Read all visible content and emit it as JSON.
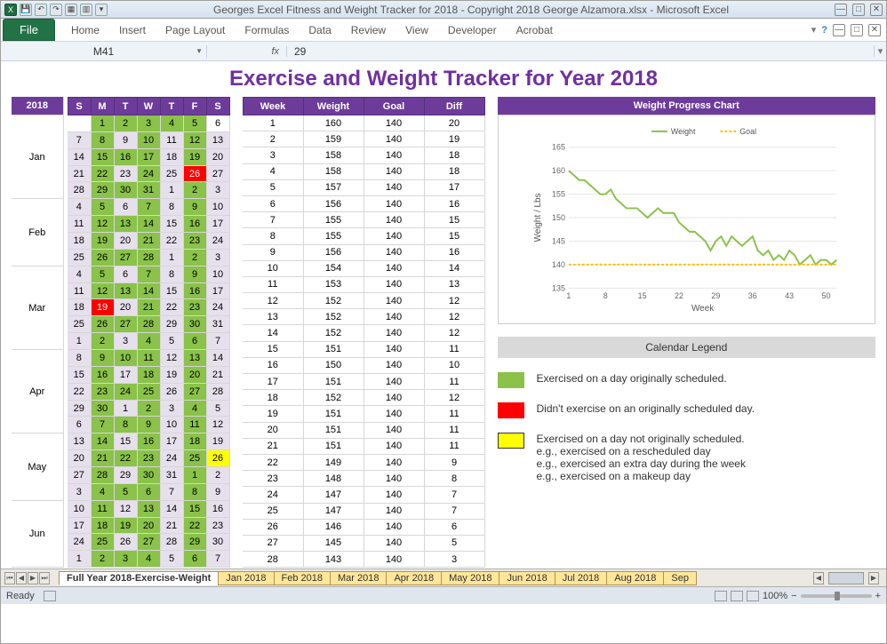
{
  "window_title": "Georges Excel Fitness and Weight Tracker for 2018 - Copyright 2018 George Alzamora.xlsx  -  Microsoft Excel",
  "ribbon": {
    "file": "File",
    "tabs": [
      "Home",
      "Insert",
      "Page Layout",
      "Formulas",
      "Data",
      "Review",
      "View",
      "Developer",
      "Acrobat"
    ]
  },
  "formula": {
    "name_box": "M41",
    "fx": "fx",
    "value": "29"
  },
  "page_title": "Exercise and Weight Tracker for Year 2018",
  "year_label": "2018",
  "months": [
    "Jan",
    "Feb",
    "Mar",
    "Apr",
    "May",
    "Jun"
  ],
  "dow": [
    "S",
    "M",
    "T",
    "W",
    "T",
    "F",
    "S"
  ],
  "calendar_rows": [
    [
      "",
      "1",
      "2",
      "3",
      "4",
      "5",
      "6",
      "",
      "g",
      "g",
      "g",
      "g",
      "g",
      ""
    ],
    [
      "7",
      "8",
      "9",
      "10",
      "11",
      "12",
      "13",
      "p",
      "g",
      "p",
      "g",
      "p",
      "g",
      "p"
    ],
    [
      "14",
      "15",
      "16",
      "17",
      "18",
      "19",
      "20",
      "p",
      "g",
      "g",
      "g",
      "p",
      "g",
      "p"
    ],
    [
      "21",
      "22",
      "23",
      "24",
      "25",
      "26",
      "27",
      "p",
      "g",
      "p",
      "g",
      "p",
      "r",
      "p"
    ],
    [
      "28",
      "29",
      "30",
      "31",
      "1",
      "2",
      "3",
      "p",
      "g",
      "g",
      "g",
      "p",
      "g",
      "p"
    ],
    [
      "4",
      "5",
      "6",
      "7",
      "8",
      "9",
      "10",
      "p",
      "g",
      "p",
      "g",
      "p",
      "g",
      "p"
    ],
    [
      "11",
      "12",
      "13",
      "14",
      "15",
      "16",
      "17",
      "p",
      "g",
      "g",
      "g",
      "p",
      "g",
      "p"
    ],
    [
      "18",
      "19",
      "20",
      "21",
      "22",
      "23",
      "24",
      "p",
      "g",
      "p",
      "g",
      "p",
      "g",
      "p"
    ],
    [
      "25",
      "26",
      "27",
      "28",
      "1",
      "2",
      "3",
      "p",
      "g",
      "g",
      "g",
      "p",
      "g",
      "p"
    ],
    [
      "4",
      "5",
      "6",
      "7",
      "8",
      "9",
      "10",
      "p",
      "g",
      "p",
      "g",
      "p",
      "g",
      "p"
    ],
    [
      "11",
      "12",
      "13",
      "14",
      "15",
      "16",
      "17",
      "p",
      "g",
      "g",
      "g",
      "p",
      "g",
      "p"
    ],
    [
      "18",
      "19",
      "20",
      "21",
      "22",
      "23",
      "24",
      "p",
      "r",
      "p",
      "g",
      "p",
      "g",
      "p"
    ],
    [
      "25",
      "26",
      "27",
      "28",
      "29",
      "30",
      "31",
      "p",
      "g",
      "g",
      "g",
      "p",
      "g",
      "p"
    ],
    [
      "1",
      "2",
      "3",
      "4",
      "5",
      "6",
      "7",
      "p",
      "g",
      "p",
      "g",
      "p",
      "g",
      "p"
    ],
    [
      "8",
      "9",
      "10",
      "11",
      "12",
      "13",
      "14",
      "p",
      "g",
      "g",
      "g",
      "p",
      "g",
      "p"
    ],
    [
      "15",
      "16",
      "17",
      "18",
      "19",
      "20",
      "21",
      "p",
      "g",
      "p",
      "g",
      "p",
      "g",
      "p"
    ],
    [
      "22",
      "23",
      "24",
      "25",
      "26",
      "27",
      "28",
      "p",
      "g",
      "g",
      "g",
      "p",
      "g",
      "p"
    ],
    [
      "29",
      "30",
      "1",
      "2",
      "3",
      "4",
      "5",
      "p",
      "g",
      "p",
      "g",
      "p",
      "g",
      "p"
    ],
    [
      "6",
      "7",
      "8",
      "9",
      "10",
      "11",
      "12",
      "p",
      "g",
      "g",
      "g",
      "p",
      "g",
      "p"
    ],
    [
      "13",
      "14",
      "15",
      "16",
      "17",
      "18",
      "19",
      "p",
      "g",
      "p",
      "g",
      "p",
      "g",
      "p"
    ],
    [
      "20",
      "21",
      "22",
      "23",
      "24",
      "25",
      "26",
      "p",
      "g",
      "g",
      "g",
      "p",
      "g",
      "y"
    ],
    [
      "27",
      "28",
      "29",
      "30",
      "31",
      "1",
      "2",
      "p",
      "g",
      "p",
      "g",
      "p",
      "g",
      "p"
    ],
    [
      "3",
      "4",
      "5",
      "6",
      "7",
      "8",
      "9",
      "p",
      "g",
      "g",
      "g",
      "p",
      "g",
      "p"
    ],
    [
      "10",
      "11",
      "12",
      "13",
      "14",
      "15",
      "16",
      "p",
      "g",
      "p",
      "g",
      "p",
      "g",
      "p"
    ],
    [
      "17",
      "18",
      "19",
      "20",
      "21",
      "22",
      "23",
      "p",
      "g",
      "g",
      "g",
      "p",
      "g",
      "p"
    ],
    [
      "24",
      "25",
      "26",
      "27",
      "28",
      "29",
      "30",
      "p",
      "g",
      "p",
      "g",
      "p",
      "g",
      "p"
    ],
    [
      "1",
      "2",
      "3",
      "4",
      "5",
      "6",
      "7",
      "p",
      "g",
      "g",
      "g",
      "p",
      "g",
      "p"
    ]
  ],
  "weight_header": [
    "Week",
    "Weight",
    "Goal",
    "Diff"
  ],
  "weight_rows": [
    [
      1,
      160,
      140,
      20
    ],
    [
      2,
      159,
      140,
      19
    ],
    [
      3,
      158,
      140,
      18
    ],
    [
      4,
      158,
      140,
      18
    ],
    [
      5,
      157,
      140,
      17
    ],
    [
      6,
      156,
      140,
      16
    ],
    [
      7,
      155,
      140,
      15
    ],
    [
      8,
      155,
      140,
      15
    ],
    [
      9,
      156,
      140,
      16
    ],
    [
      10,
      154,
      140,
      14
    ],
    [
      11,
      153,
      140,
      13
    ],
    [
      12,
      152,
      140,
      12
    ],
    [
      13,
      152,
      140,
      12
    ],
    [
      14,
      152,
      140,
      12
    ],
    [
      15,
      151,
      140,
      11
    ],
    [
      16,
      150,
      140,
      10
    ],
    [
      17,
      151,
      140,
      11
    ],
    [
      18,
      152,
      140,
      12
    ],
    [
      19,
      151,
      140,
      11
    ],
    [
      20,
      151,
      140,
      11
    ],
    [
      21,
      151,
      140,
      11
    ],
    [
      22,
      149,
      140,
      9
    ],
    [
      23,
      148,
      140,
      8
    ],
    [
      24,
      147,
      140,
      7
    ],
    [
      25,
      147,
      140,
      7
    ],
    [
      26,
      146,
      140,
      6
    ],
    [
      27,
      145,
      140,
      5
    ],
    [
      28,
      143,
      140,
      3
    ]
  ],
  "chart_title": "Weight Progress Chart",
  "chart_data": {
    "type": "line",
    "title": "Weight Progress Chart",
    "xlabel": "Week",
    "ylabel": "Weight / Lbs",
    "x_ticks": [
      1,
      8,
      15,
      22,
      29,
      36,
      43,
      50
    ],
    "y_ticks": [
      135,
      140,
      145,
      150,
      155,
      160,
      165
    ],
    "ylim": [
      135,
      165
    ],
    "x": [
      1,
      2,
      3,
      4,
      5,
      6,
      7,
      8,
      9,
      10,
      11,
      12,
      13,
      14,
      15,
      16,
      17,
      18,
      19,
      20,
      21,
      22,
      23,
      24,
      25,
      26,
      27,
      28,
      29,
      30,
      31,
      32,
      33,
      34,
      35,
      36,
      37,
      38,
      39,
      40,
      41,
      42,
      43,
      44,
      45,
      46,
      47,
      48,
      49,
      50,
      51,
      52
    ],
    "series": [
      {
        "name": "Weight",
        "color": "#8ac24a",
        "values": [
          160,
          159,
          158,
          158,
          157,
          156,
          155,
          155,
          156,
          154,
          153,
          152,
          152,
          152,
          151,
          150,
          151,
          152,
          151,
          151,
          151,
          149,
          148,
          147,
          147,
          146,
          145,
          143,
          145,
          146,
          144,
          146,
          145,
          144,
          145,
          146,
          143,
          142,
          143,
          141,
          142,
          141,
          143,
          142,
          140,
          141,
          142,
          140,
          141,
          141,
          140,
          141
        ]
      },
      {
        "name": "Goal",
        "color": "#ffc000",
        "values": [
          140,
          140,
          140,
          140,
          140,
          140,
          140,
          140,
          140,
          140,
          140,
          140,
          140,
          140,
          140,
          140,
          140,
          140,
          140,
          140,
          140,
          140,
          140,
          140,
          140,
          140,
          140,
          140,
          140,
          140,
          140,
          140,
          140,
          140,
          140,
          140,
          140,
          140,
          140,
          140,
          140,
          140,
          140,
          140,
          140,
          140,
          140,
          140,
          140,
          140,
          140,
          140
        ]
      }
    ]
  },
  "legend_title": "Calendar Legend",
  "legend_items": [
    {
      "swatch": "sw-g",
      "text": "Exercised on a day originally scheduled."
    },
    {
      "swatch": "sw-r",
      "text": "Didn't exercise on an originally scheduled day."
    },
    {
      "swatch": "sw-y",
      "text": "Exercised on a day not originally scheduled.\ne.g., exercised on a rescheduled day\ne.g., exercised an extra day during the week\ne.g., exercised on a makeup day"
    }
  ],
  "sheet_tabs": [
    "Full Year 2018-Exercise-Weight",
    "Jan 2018",
    "Feb 2018",
    "Mar 2018",
    "Apr 2018",
    "May 2018",
    "Jun 2018",
    "Jul 2018",
    "Aug 2018",
    "Sep"
  ],
  "status": {
    "ready": "Ready",
    "zoom": "100%"
  }
}
